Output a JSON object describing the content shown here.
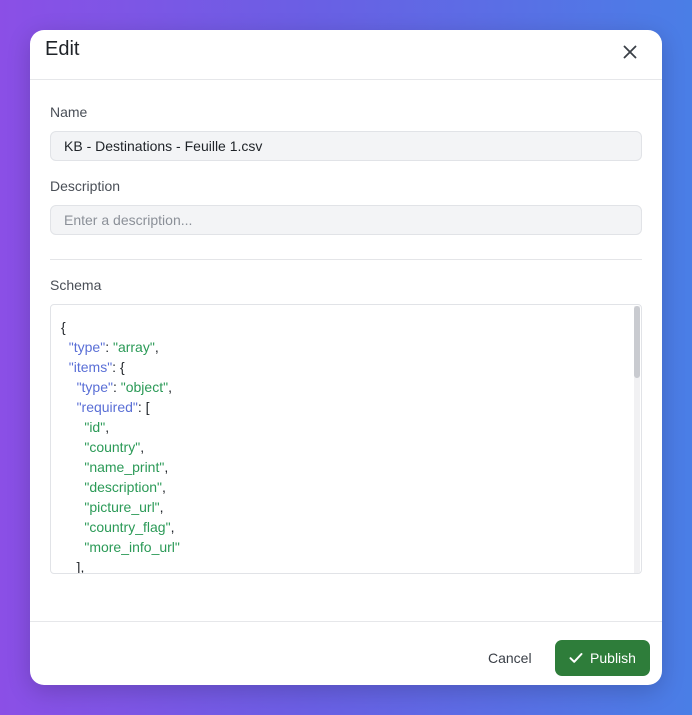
{
  "dialog": {
    "title": "Edit",
    "close_icon": "close-icon"
  },
  "name_field": {
    "label": "Name",
    "value": "KB - Destinations - Feuille 1.csv"
  },
  "description_field": {
    "label": "Description",
    "value": "",
    "placeholder": "Enter a description..."
  },
  "schema": {
    "label": "Schema",
    "lines": [
      [
        {
          "t": "{",
          "c": ""
        }
      ],
      [
        {
          "t": "  ",
          "c": ""
        },
        {
          "t": "\"type\"",
          "c": "k"
        },
        {
          "t": ": ",
          "c": ""
        },
        {
          "t": "\"array\"",
          "c": "s"
        },
        {
          "t": ",",
          "c": ""
        }
      ],
      [
        {
          "t": "  ",
          "c": ""
        },
        {
          "t": "\"items\"",
          "c": "k"
        },
        {
          "t": ": {",
          "c": ""
        }
      ],
      [
        {
          "t": "    ",
          "c": ""
        },
        {
          "t": "\"type\"",
          "c": "k"
        },
        {
          "t": ": ",
          "c": ""
        },
        {
          "t": "\"object\"",
          "c": "s"
        },
        {
          "t": ",",
          "c": ""
        }
      ],
      [
        {
          "t": "    ",
          "c": ""
        },
        {
          "t": "\"required\"",
          "c": "k"
        },
        {
          "t": ": [",
          "c": ""
        }
      ],
      [
        {
          "t": "      ",
          "c": ""
        },
        {
          "t": "\"id\"",
          "c": "s"
        },
        {
          "t": ",",
          "c": ""
        }
      ],
      [
        {
          "t": "      ",
          "c": ""
        },
        {
          "t": "\"country\"",
          "c": "s"
        },
        {
          "t": ",",
          "c": ""
        }
      ],
      [
        {
          "t": "      ",
          "c": ""
        },
        {
          "t": "\"name_print\"",
          "c": "s"
        },
        {
          "t": ",",
          "c": ""
        }
      ],
      [
        {
          "t": "      ",
          "c": ""
        },
        {
          "t": "\"description\"",
          "c": "s"
        },
        {
          "t": ",",
          "c": ""
        }
      ],
      [
        {
          "t": "      ",
          "c": ""
        },
        {
          "t": "\"picture_url\"",
          "c": "s"
        },
        {
          "t": ",",
          "c": ""
        }
      ],
      [
        {
          "t": "      ",
          "c": ""
        },
        {
          "t": "\"country_flag\"",
          "c": "s"
        },
        {
          "t": ",",
          "c": ""
        }
      ],
      [
        {
          "t": "      ",
          "c": ""
        },
        {
          "t": "\"more_info_url\"",
          "c": "s"
        }
      ],
      [
        {
          "t": "    ],",
          "c": ""
        }
      ]
    ]
  },
  "footer": {
    "cancel_label": "Cancel",
    "publish_label": "Publish",
    "publish_icon": "check-icon"
  },
  "colors": {
    "publish_button": "#2e7d3a",
    "json_key": "#5a6fd6",
    "json_string": "#2b9a57"
  }
}
